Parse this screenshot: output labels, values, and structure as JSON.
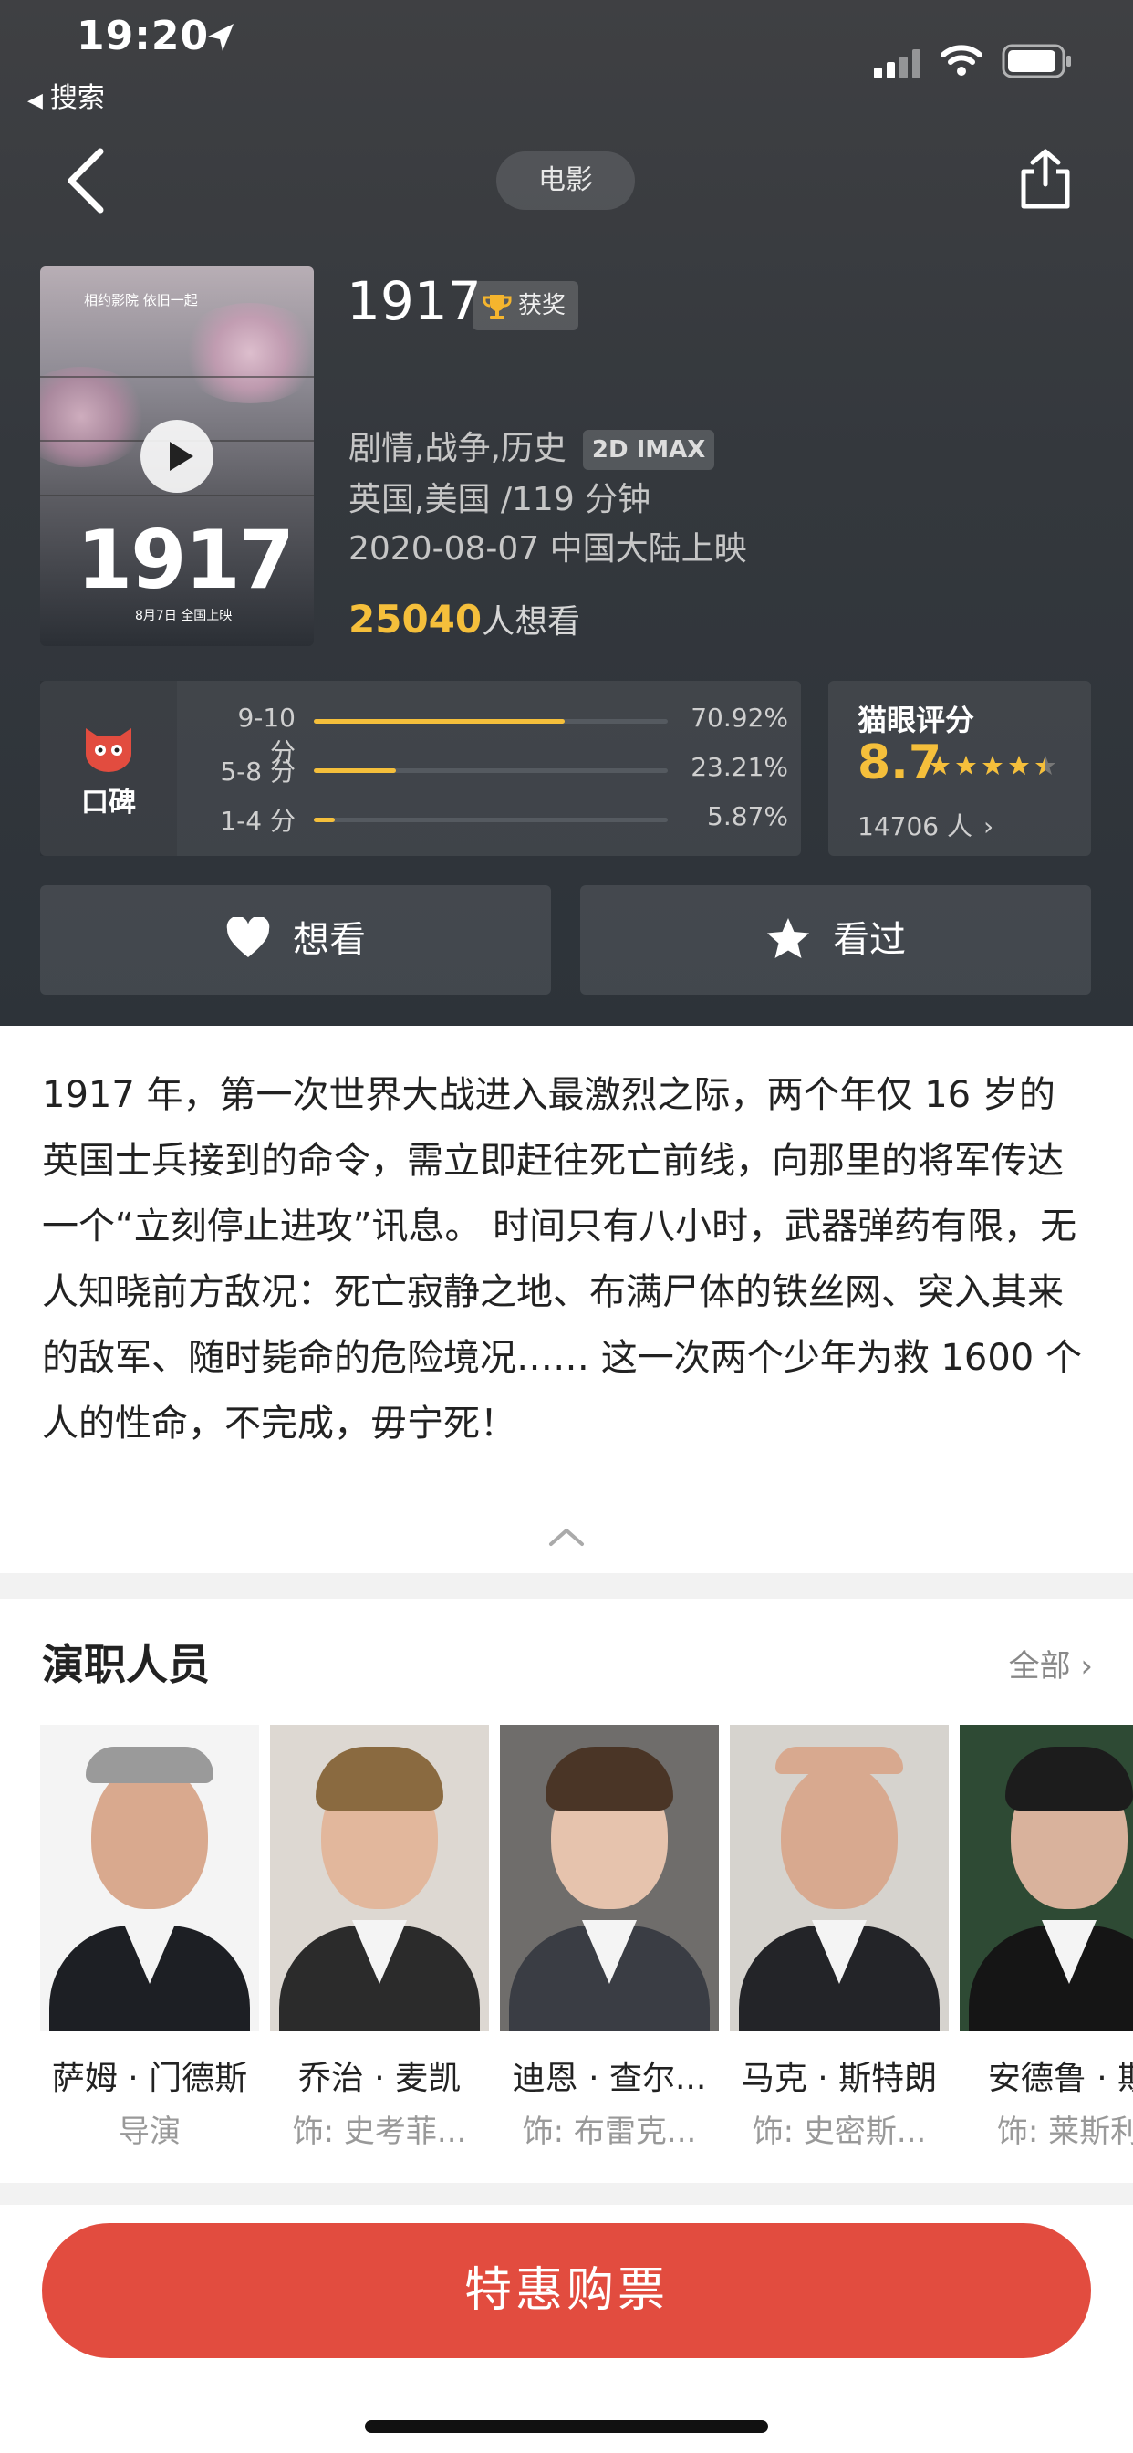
{
  "status": {
    "time": "19:20",
    "back_app": "搜索"
  },
  "nav": {
    "category": "电影"
  },
  "movie": {
    "poster": {
      "tagline": "相约影院 依旧一起",
      "big_title": "1917",
      "release_text": "8月7日 全国上映"
    },
    "title": "1917",
    "award_badge": "获奖",
    "genres": "剧情,战争,历史",
    "format": "2D IMAX",
    "country_duration": "英国,美国 /119 分钟",
    "release": "2020-08-07 中国大陆上映",
    "wish_count": "25040",
    "wish_suffix": "人想看"
  },
  "koubei": {
    "label": "口碑",
    "rows": [
      {
        "label": "9-10 分",
        "percent_text": "70.92%",
        "fraction": 0.7092
      },
      {
        "label": "5-8 分",
        "percent_text": "23.21%",
        "fraction": 0.2321
      },
      {
        "label": "1-4 分",
        "percent_text": "5.87%",
        "fraction": 0.0587
      }
    ]
  },
  "maoyan": {
    "title": "猫眼评分",
    "score": "8.7",
    "stars": 4.5,
    "count": "14706 人"
  },
  "actions": {
    "want": "想看",
    "seen": "看过"
  },
  "synopsis": "1917 年，第一次世界大战进入最激烈之际，两个年仅 16 岁的英国士兵接到的命令，需立即赶往死亡前线，向那里的将军传达一个“立刻停止进攻”讯息。 时间只有八小时，武器弹药有限，无人知晓前方敌况：死亡寂静之地、布满尸体的铁丝网、突入其来的敌军、随时毙命的危险境况…… 这一次两个少年为救 1600 个人的性命，不完成，毋宁死！",
  "cast": {
    "title": "演职人员",
    "all_label": "全部",
    "members": [
      {
        "name": "萨姆 · 门德斯",
        "role": "导演"
      },
      {
        "name": "乔治 · 麦凯",
        "role": "饰: 史考菲..."
      },
      {
        "name": "迪恩 · 查尔...",
        "role": "饰: 布雷克..."
      },
      {
        "name": "马克 · 斯特朗",
        "role": "饰: 史密斯..."
      },
      {
        "name": "安德鲁 · 斯",
        "role": "饰: 莱斯利"
      }
    ]
  },
  "buy_button": "特惠购票",
  "colors": {
    "accent_gold": "#f5bf3b",
    "buy_red": "#e24c3f",
    "hero_bg": "#34383d"
  }
}
